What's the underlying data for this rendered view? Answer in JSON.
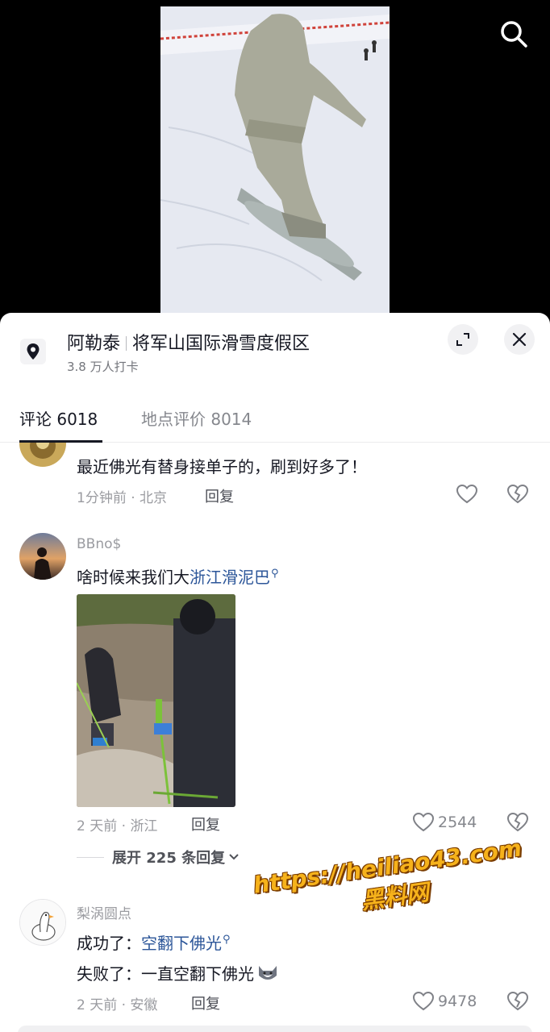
{
  "video": {
    "search_icon": "search-icon"
  },
  "location": {
    "name": "阿勒泰",
    "place": "将军山国际滑雪度假区",
    "checkins": "3.8 万人打卡",
    "pin_icon": "location-pin-icon",
    "expand_icon": "expand-icon",
    "close_icon": "close-icon"
  },
  "tabs": {
    "comments": "评论 6018",
    "reviews": "地点评价 8014"
  },
  "comments": [
    {
      "text": "最近佛光有替身接单子的，刷到好多了！",
      "time_location": "1分钟前 · 北京",
      "reply": "回复"
    },
    {
      "user": "BBno$",
      "text_prefix": "啥时候来我们大",
      "link": "浙江滑泥巴",
      "time_location": "2 天前 · 浙江",
      "reply": "回复",
      "likes": "2544",
      "expand": "展开 225 条回复"
    },
    {
      "user": "梨涡圆点",
      "line1_prefix": "成功了：",
      "line1_link": "空翻下佛光",
      "line2": "失败了：一直空翻下佛光",
      "time_location": "2 天前 · 安徽",
      "reply": "回复",
      "likes": "9478"
    }
  ],
  "watermark": {
    "url": "https://heiliao43.com",
    "name": "黑料网"
  }
}
